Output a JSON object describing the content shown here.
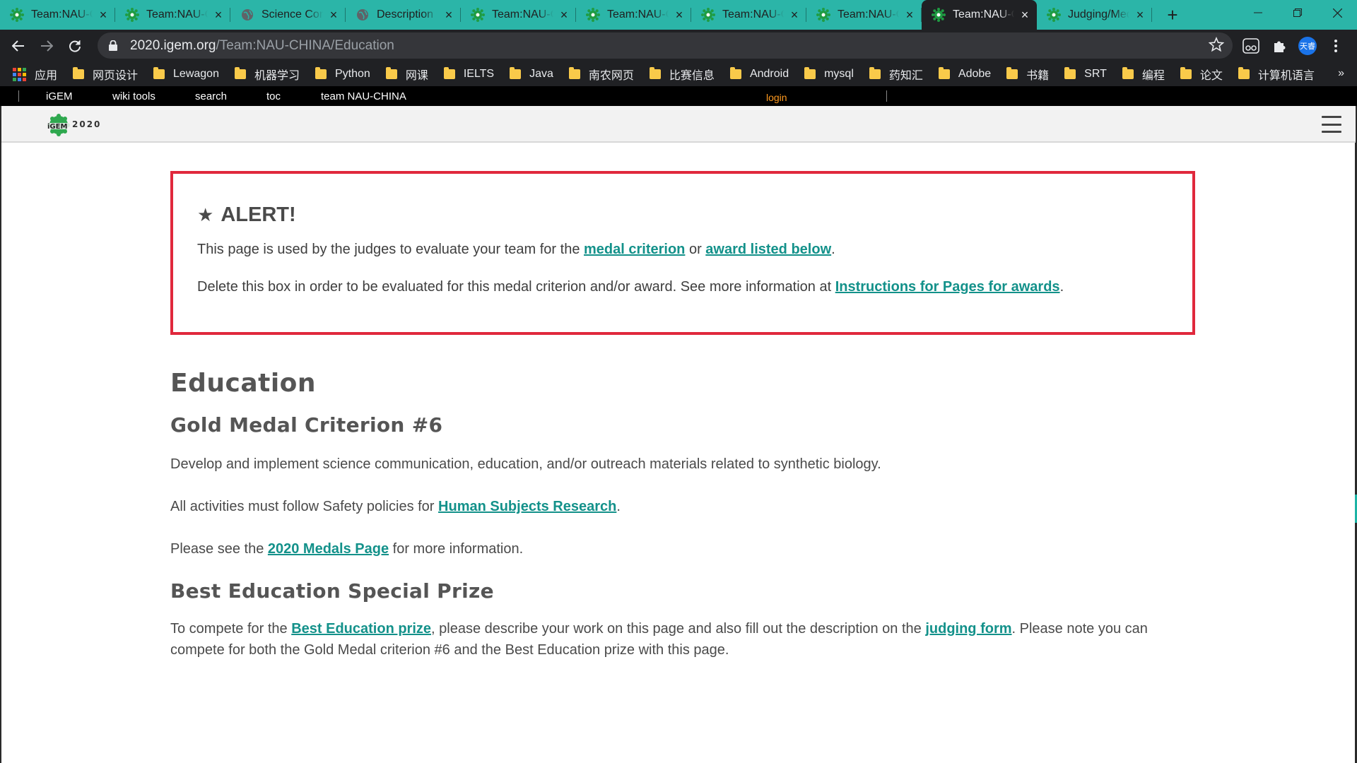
{
  "browser": {
    "tabs": [
      {
        "title": "Team:NAU-CHINA",
        "icon": "igem-favicon",
        "active": false
      },
      {
        "title": "Team:NAU-CHINA",
        "icon": "igem-favicon",
        "active": false
      },
      {
        "title": "Science Communication",
        "icon": "globe-icon",
        "active": false
      },
      {
        "title": "Description",
        "icon": "globe-icon",
        "active": false
      },
      {
        "title": "Team:NAU-CHINA",
        "icon": "igem-favicon",
        "active": false
      },
      {
        "title": "Team:NAU-CHINA",
        "icon": "igem-favicon",
        "active": false
      },
      {
        "title": "Team:NAU-CHINA",
        "icon": "igem-favicon",
        "active": false
      },
      {
        "title": "Team:NAU-CHINA",
        "icon": "igem-favicon",
        "active": false
      },
      {
        "title": "Team:NAU-CHINA",
        "icon": "igem-favicon",
        "active": true
      },
      {
        "title": "Judging/Medals",
        "icon": "igem-favicon",
        "active": false
      }
    ],
    "new_tab_label": "+",
    "url_host": "2020.igem.org",
    "url_path": "/Team:NAU-CHINA/Education",
    "profile_label": "天睿",
    "bookmarks": [
      {
        "label": "应用",
        "type": "apps"
      },
      {
        "label": "网页设计",
        "type": "folder"
      },
      {
        "label": "Lewagon",
        "type": "folder"
      },
      {
        "label": "机器学习",
        "type": "folder"
      },
      {
        "label": "Python",
        "type": "folder"
      },
      {
        "label": "网课",
        "type": "folder"
      },
      {
        "label": "IELTS",
        "type": "folder"
      },
      {
        "label": "Java",
        "type": "folder"
      },
      {
        "label": "南农网页",
        "type": "folder"
      },
      {
        "label": "比赛信息",
        "type": "folder"
      },
      {
        "label": "Android",
        "type": "folder"
      },
      {
        "label": "mysql",
        "type": "folder"
      },
      {
        "label": "药知汇",
        "type": "folder"
      },
      {
        "label": "Adobe",
        "type": "folder"
      },
      {
        "label": "书籍",
        "type": "folder"
      },
      {
        "label": "SRT",
        "type": "folder"
      },
      {
        "label": "编程",
        "type": "folder"
      },
      {
        "label": "论文",
        "type": "folder"
      },
      {
        "label": "计算机语言",
        "type": "folder"
      }
    ],
    "bookmarks_overflow": "»"
  },
  "igem_bar": {
    "items": [
      "iGEM",
      "wiki tools",
      "search",
      "toc",
      "team NAU-CHINA"
    ],
    "login": "login"
  },
  "site_header": {
    "logo_text": "2020"
  },
  "alert": {
    "star": "★",
    "title": "ALERT!",
    "p1_before": "This page is used by the judges to evaluate your team for the ",
    "p1_link1": "medal criterion",
    "p1_mid": " or ",
    "p1_link2": "award listed below",
    "p1_after": ".",
    "p2_before": "Delete this box in order to be evaluated for this medal criterion and/or award. See more information at ",
    "p2_link": "Instructions for Pages for awards",
    "p2_after": "."
  },
  "main": {
    "heading": "Education",
    "gold_heading": "Gold Medal Criterion #6",
    "gold_p1": "Develop and implement science communication, education, and/or outreach materials related to synthetic biology.",
    "gold_p2_before": "All activities must follow Safety policies for ",
    "gold_p2_link": "Human Subjects Research",
    "gold_p2_after": ".",
    "gold_p3_before": "Please see the ",
    "gold_p3_link": "2020 Medals Page",
    "gold_p3_after": " for more information.",
    "prize_heading": "Best Education Special Prize",
    "prize_p_before": "To compete for the ",
    "prize_p_link1": "Best Education prize",
    "prize_p_mid": ", please describe your work on this page and also fill out the description on the ",
    "prize_p_link2": "judging form",
    "prize_p_after": ". Please note you can compete for both the Gold Medal criterion #6 and the Best Education prize with this page."
  },
  "colors": {
    "tabstrip": "#2bb5a8",
    "chrome_dark": "#202124",
    "alert_border": "#e0283c",
    "link": "#13918a",
    "login": "#ff9a1f"
  }
}
